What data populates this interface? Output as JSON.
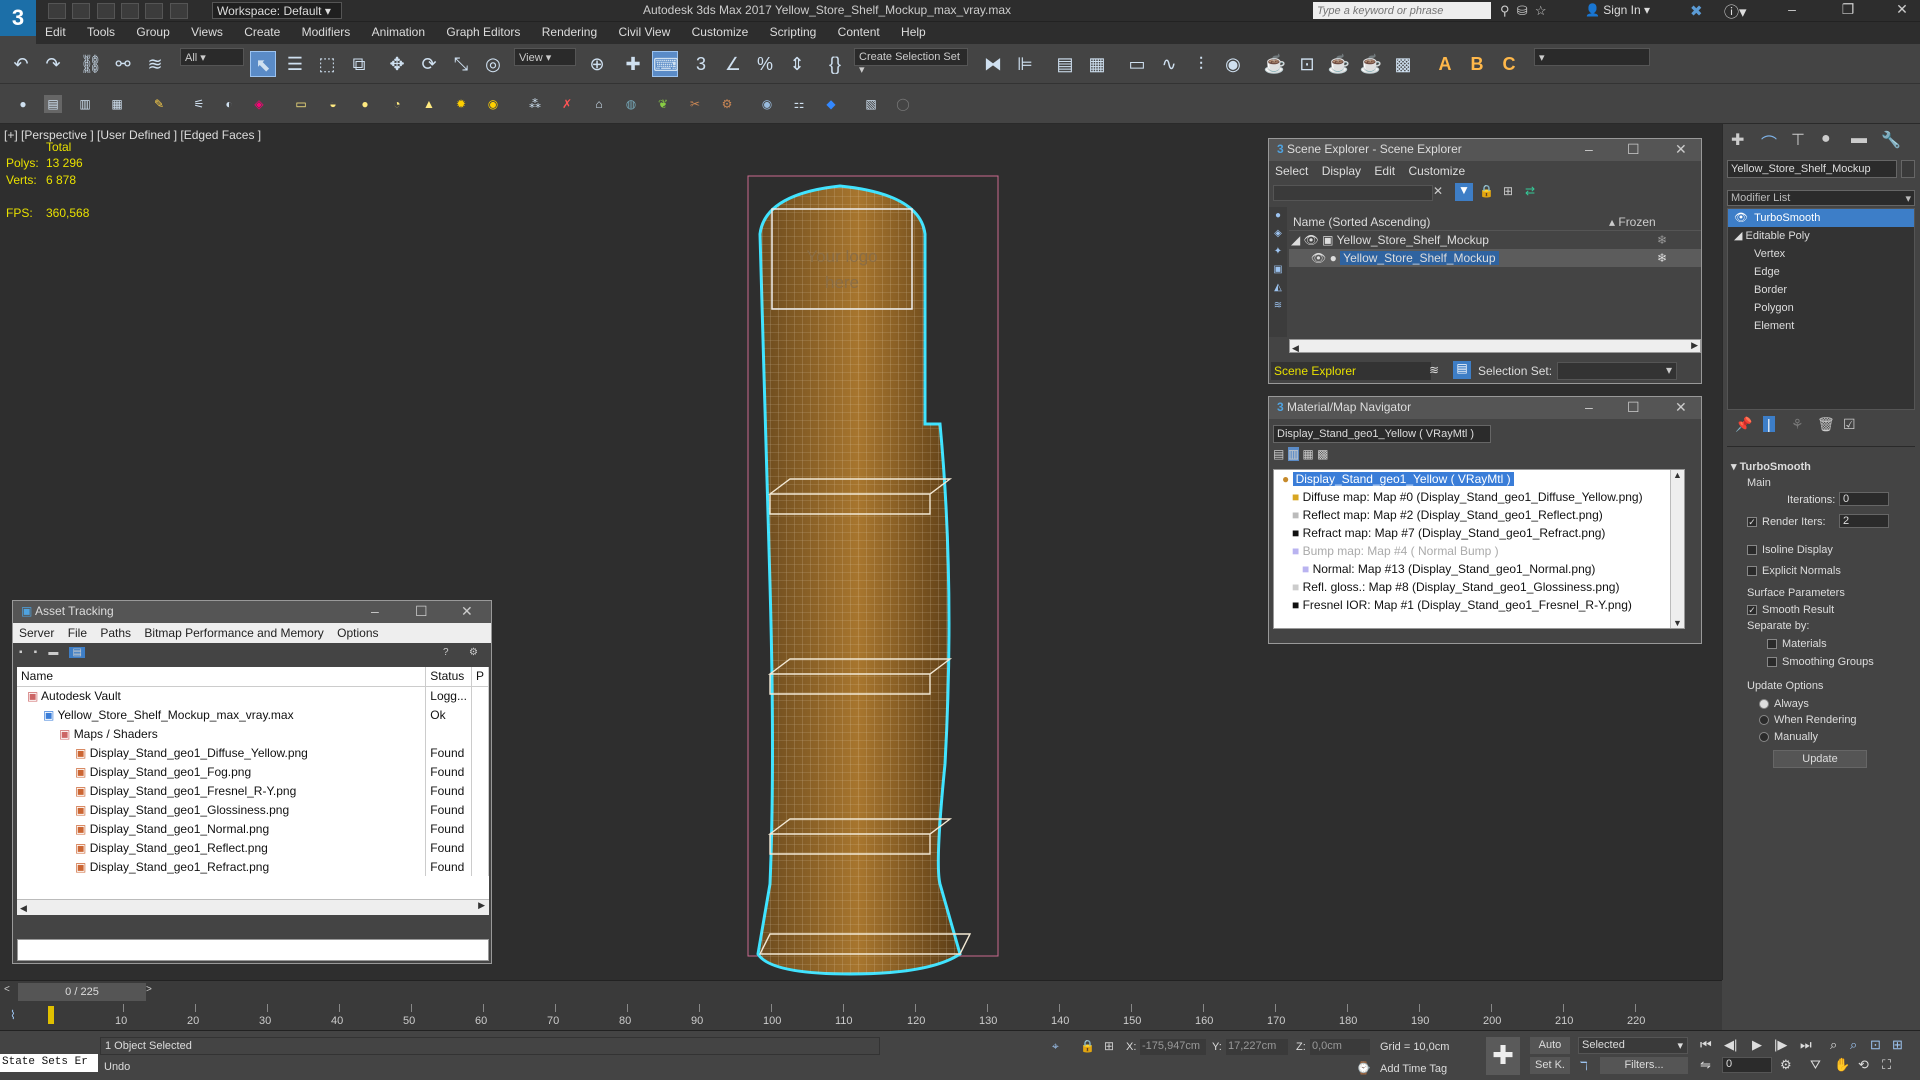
{
  "app": {
    "logo": "3",
    "workspace": "Workspace: Default",
    "title": "Autodesk 3ds Max 2017     Yellow_Store_Shelf_Mockup_max_vray.max",
    "search_placeholder": "Type a keyword or phrase",
    "sign_in": "Sign In"
  },
  "menu": [
    "Edit",
    "Tools",
    "Group",
    "Views",
    "Create",
    "Modifiers",
    "Animation",
    "Graph Editors",
    "Rendering",
    "Civil View",
    "Customize",
    "Scripting",
    "Content",
    "Help"
  ],
  "toolbar": {
    "filter": "All",
    "ref_coord": "View",
    "selection_set": "Create Selection Set"
  },
  "viewport": {
    "label": "[+] [Perspective ] [User Defined ] [Edged Faces ]",
    "total_label": "Total",
    "polys_label": "Polys:",
    "polys_value": "13 296",
    "verts_label": "Verts:",
    "verts_value": "6 878",
    "fps_label": "FPS:",
    "fps_value": "360,568",
    "logo_text_1": "Your logo",
    "logo_text_2": "here"
  },
  "scene_explorer": {
    "title": "Scene Explorer - Scene Explorer",
    "menu": [
      "Select",
      "Display",
      "Edit",
      "Customize"
    ],
    "col_name": "Name (Sorted Ascending)",
    "col_frozen": "Frozen",
    "rows": [
      "Yellow_Store_Shelf_Mockup",
      "Yellow_Store_Shelf_Mockup"
    ],
    "footer_label": "Scene Explorer",
    "selection_set_label": "Selection Set:"
  },
  "material_navigator": {
    "title": "Material/Map Navigator",
    "current": "Display_Stand_geo1_Yellow  ( VRayMtl )",
    "items": [
      "Display_Stand_geo1_Yellow  ( VRayMtl )",
      "Diffuse map: Map #0 (Display_Stand_geo1_Diffuse_Yellow.png)",
      "Reflect map: Map #2 (Display_Stand_geo1_Reflect.png)",
      "Refract map: Map #7 (Display_Stand_geo1_Refract.png)",
      "Bump map: Map #4  ( Normal Bump )",
      "Normal: Map #13 (Display_Stand_geo1_Normal.png)",
      "Refl. gloss.: Map #8 (Display_Stand_geo1_Glossiness.png)",
      "Fresnel IOR: Map #1 (Display_Stand_geo1_Fresnel_R-Y.png)"
    ]
  },
  "asset_tracking": {
    "title": "Asset Tracking",
    "menu": [
      "Server",
      "File",
      "Paths",
      "Bitmap Performance and Memory",
      "Options"
    ],
    "col_name": "Name",
    "col_status": "Status",
    "col_p": "P",
    "rows": [
      {
        "name": "Autodesk Vault",
        "status": "Logg..."
      },
      {
        "name": "Yellow_Store_Shelf_Mockup_max_vray.max",
        "status": "Ok"
      },
      {
        "name": "Maps / Shaders",
        "status": ""
      },
      {
        "name": "Display_Stand_geo1_Diffuse_Yellow.png",
        "status": "Found"
      },
      {
        "name": "Display_Stand_geo1_Fog.png",
        "status": "Found"
      },
      {
        "name": "Display_Stand_geo1_Fresnel_R-Y.png",
        "status": "Found"
      },
      {
        "name": "Display_Stand_geo1_Glossiness.png",
        "status": "Found"
      },
      {
        "name": "Display_Stand_geo1_Normal.png",
        "status": "Found"
      },
      {
        "name": "Display_Stand_geo1_Reflect.png",
        "status": "Found"
      },
      {
        "name": "Display_Stand_geo1_Refract.png",
        "status": "Found"
      }
    ]
  },
  "command_panel": {
    "object_name": "Yellow_Store_Shelf_Mockup",
    "modifier_list": "Modifier List",
    "stack": [
      "TurboSmooth",
      "Editable Poly",
      "Vertex",
      "Edge",
      "Border",
      "Polygon",
      "Element"
    ],
    "rollout_title": "TurboSmooth",
    "main_label": "Main",
    "iterations_label": "Iterations:",
    "iterations_value": "0",
    "render_iters_label": "Render Iters:",
    "render_iters_value": "2",
    "isoline": "Isoline Display",
    "explicit_normals": "Explicit Normals",
    "surface_params": "Surface Parameters",
    "smooth_result": "Smooth Result",
    "separate_by": "Separate by:",
    "materials": "Materials",
    "smoothing_groups": "Smoothing Groups",
    "update_options": "Update Options",
    "always": "Always",
    "when_rendering": "When Rendering",
    "manually": "Manually",
    "update_button": "Update"
  },
  "timeline": {
    "frame": "0 / 225",
    "ticks": [
      "10",
      "20",
      "30",
      "40",
      "50",
      "60",
      "70",
      "80",
      "90",
      "100",
      "110",
      "120",
      "130",
      "140",
      "150",
      "160",
      "170",
      "180",
      "190",
      "200",
      "210",
      "220"
    ]
  },
  "status": {
    "maxscript": "State Sets Er",
    "selected": "1 Object Selected",
    "prompt": "Undo",
    "x_label": "X:",
    "x_value": "-175,947cm",
    "y_label": "Y:",
    "y_value": "17,227cm",
    "z_label": "Z:",
    "z_value": "0,0cm",
    "grid": "Grid = 10,0cm",
    "add_time_tag": "Add Time Tag",
    "auto": "Auto",
    "set_key": "Set K.",
    "key_filter": "Selected",
    "filters": "Filters...",
    "frame_field": "0"
  }
}
